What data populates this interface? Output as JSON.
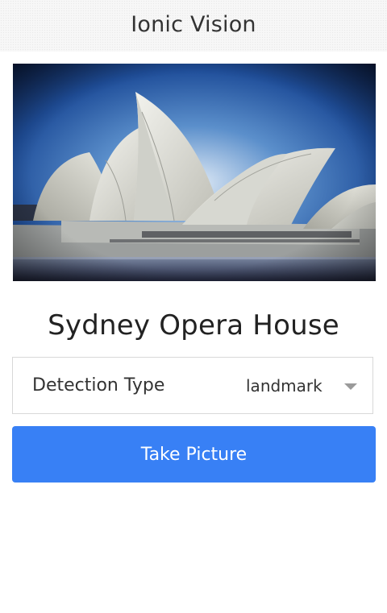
{
  "header": {
    "title": "Ionic Vision"
  },
  "image": {
    "subject": "Sydney Opera House photo"
  },
  "result": {
    "title": "Sydney Opera House"
  },
  "detection": {
    "label": "Detection Type",
    "selected": "landmark"
  },
  "actions": {
    "take_picture_label": "Take Picture"
  },
  "colors": {
    "accent": "#3880f5",
    "header_bg": "#f7f7f7",
    "text": "#333333"
  }
}
